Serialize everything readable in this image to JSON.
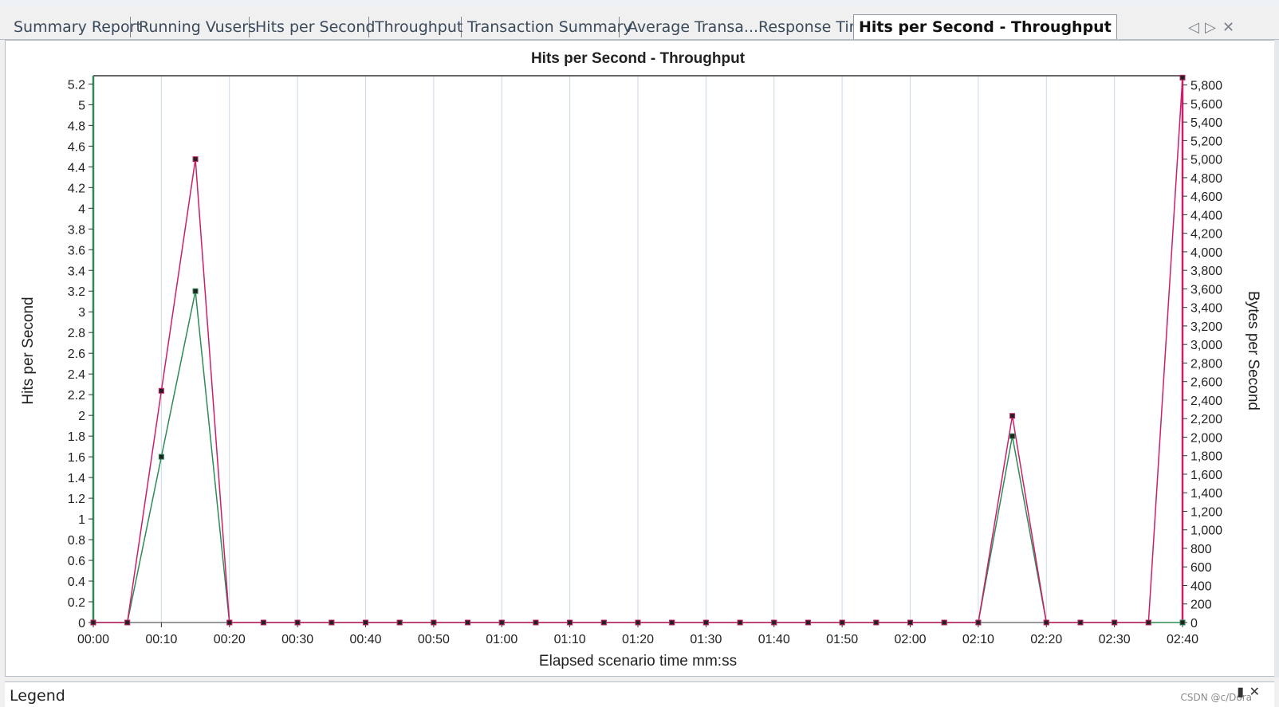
{
  "tabs": [
    {
      "label": "Summary Report",
      "active": false
    },
    {
      "label": "Running Vusers",
      "active": false
    },
    {
      "label": "Hits per Second",
      "active": false
    },
    {
      "label": "Throughput",
      "active": false
    },
    {
      "label": "Transaction Summary",
      "active": false
    },
    {
      "label": "Average Transa...Response Time",
      "active": false
    },
    {
      "label": "Hits per Second - Throughput",
      "active": true
    }
  ],
  "tab_nav": {
    "prev_icon": "◁",
    "next_icon": "▷",
    "close_icon": "✕"
  },
  "legend": {
    "label": "Legend",
    "pin_icon": "pin-icon",
    "close_icon": "close-icon"
  },
  "watermark": "CSDN @c/Dora",
  "colors": {
    "hits_series": "#2e8b57",
    "throughput_series": "#cc1f6a",
    "left_axis": "#2e8b57",
    "right_axis": "#cc1f6a",
    "gridline": "#c7d9ec"
  },
  "chart_data": {
    "type": "line",
    "title": "Hits per Second - Throughput",
    "xlabel": "Elapsed scenario time mm:ss",
    "ylabel": "Hits per Second",
    "y2label": "Bytes per Second",
    "x_ticks": [
      "00:00",
      "00:10",
      "00:20",
      "00:30",
      "00:40",
      "00:50",
      "01:00",
      "01:10",
      "01:20",
      "01:30",
      "01:40",
      "01:50",
      "02:00",
      "02:10",
      "02:20",
      "02:30",
      "02:40"
    ],
    "x": [
      "00:00",
      "00:05",
      "00:10",
      "00:15",
      "00:20",
      "00:25",
      "00:30",
      "00:35",
      "00:40",
      "00:45",
      "00:50",
      "00:55",
      "01:00",
      "01:05",
      "01:10",
      "01:15",
      "01:20",
      "01:25",
      "01:30",
      "01:35",
      "01:40",
      "01:45",
      "01:50",
      "01:55",
      "02:00",
      "02:05",
      "02:10",
      "02:15",
      "02:20",
      "02:25",
      "02:30",
      "02:35",
      "02:40"
    ],
    "y_ticks": [
      "0",
      "0.2",
      "0.4",
      "0.6",
      "0.8",
      "1",
      "1.2",
      "1.4",
      "1.6",
      "1.8",
      "2",
      "2.2",
      "2.4",
      "2.6",
      "2.8",
      "3",
      "3.2",
      "3.4",
      "3.6",
      "3.8",
      "4",
      "4.2",
      "4.4",
      "4.6",
      "4.8",
      "5",
      "5.2"
    ],
    "y2_ticks": [
      "0",
      "200",
      "400",
      "600",
      "800",
      "1,000",
      "1,200",
      "1,400",
      "1,600",
      "1,800",
      "2,000",
      "2,200",
      "2,400",
      "2,600",
      "2,800",
      "3,000",
      "3,200",
      "3,400",
      "3,600",
      "3,800",
      "4,000",
      "4,200",
      "4,400",
      "4,600",
      "4,800",
      "5,000",
      "5,200",
      "5,400",
      "5,600",
      "5,800"
    ],
    "ylim": [
      0,
      5.28
    ],
    "y2lim": [
      0,
      5900
    ],
    "series": [
      {
        "axis": "left",
        "values": [
          0,
          0,
          1.6,
          3.2,
          0,
          0,
          0,
          0,
          0,
          0,
          0,
          0,
          0,
          0,
          0,
          0,
          0,
          0,
          0,
          0,
          0,
          0,
          0,
          0,
          0,
          0,
          0,
          1.8,
          0,
          0,
          0,
          0,
          0
        ]
      },
      {
        "axis": "right",
        "values": [
          0,
          0,
          2500,
          5000,
          0,
          0,
          0,
          0,
          0,
          0,
          0,
          0,
          0,
          0,
          0,
          0,
          0,
          0,
          0,
          0,
          0,
          0,
          0,
          0,
          0,
          0,
          0,
          2230,
          0,
          0,
          0,
          0,
          5880
        ]
      }
    ],
    "grid": true,
    "legend_position": "bottom"
  }
}
